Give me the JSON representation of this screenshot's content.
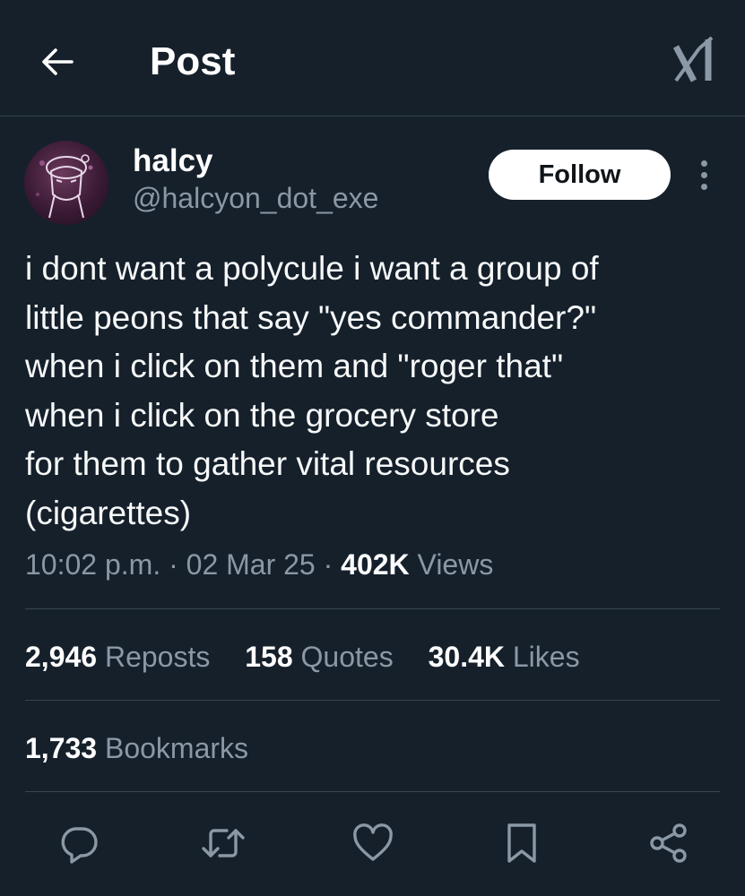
{
  "header": {
    "title": "Post",
    "back_icon": "arrow-left-icon",
    "logo_icon": "x-logo-icon"
  },
  "author": {
    "display_name": "halcy",
    "handle": "@halcyon_dot_exe",
    "avatar_icon": "avatar-image",
    "follow_label": "Follow",
    "more_icon": "more-vertical-icon"
  },
  "post": {
    "lines": [
      "i dont want a polycule i want a group of",
      "little peons that say \"yes commander?\"",
      "when i click on them and \"roger that\"",
      "when i click on the grocery store",
      "for them to gather vital resources",
      "(cigarettes)"
    ],
    "time": "10:02 p.m.",
    "sep1": "·",
    "date": "02 Mar 25",
    "sep2": "·",
    "views_count": "402K",
    "views_label": "Views"
  },
  "stats": {
    "reposts_count": "2,946",
    "reposts_label": "Reposts",
    "quotes_count": "158",
    "quotes_label": "Quotes",
    "likes_count": "30.4K",
    "likes_label": "Likes",
    "bookmarks_count": "1,733",
    "bookmarks_label": "Bookmarks"
  },
  "actions": {
    "reply_icon": "reply-icon",
    "repost_icon": "repost-icon",
    "like_icon": "heart-icon",
    "bookmark_icon": "bookmark-icon",
    "share_icon": "share-icon"
  },
  "colors": {
    "background": "#15202b",
    "text_primary": "#ffffff",
    "text_secondary": "#8b98a5",
    "divider": "#38444d"
  }
}
